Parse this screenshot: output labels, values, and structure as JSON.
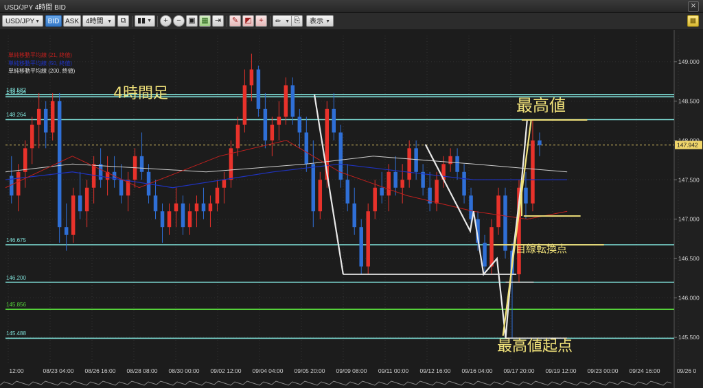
{
  "window": {
    "title": "USD/JPY 4時間 BID",
    "close_glyph": "×"
  },
  "toolbar": {
    "symbol": "USD/JPY",
    "bid_label": "BID",
    "ask_label": "ASK",
    "timeframe": "4時間",
    "display_label": "表示"
  },
  "icons": [
    "copy-icon",
    "bar-chart-icon",
    "zoom-in-icon",
    "zoom-out-icon",
    "fit-icon",
    "grid-icon",
    "scroll-icon",
    "draw-line-icon",
    "draw-shape-icon",
    "draw-fib-icon",
    "pen-icon",
    "screenshot-icon",
    "menu-icon"
  ],
  "colors": {
    "bull": "#e8322b",
    "bear": "#2f6fd6",
    "ma21": "#c0201e",
    "ma50": "#1f33c0",
    "ma200": "#cfcfcf",
    "accent_yellow": "#f1e27a",
    "hline": "#7fe0d8",
    "green_line": "#55d23a",
    "white_line": "#e8e8e8",
    "price_tag": "#f0d56a"
  },
  "chart_data": {
    "type": "candlestick",
    "title": "4時間足",
    "legend": [
      {
        "name": "単純移動平均線 (21, 終値)",
        "color": "#c0201e"
      },
      {
        "name": "単純移動平均線 (50, 終値)",
        "color": "#1f33c0"
      },
      {
        "name": "単純移動平均線 (200, 終値)",
        "color": "#dddddd"
      }
    ],
    "y_ticks": [
      "149.000",
      "148.500",
      "148.000",
      "147.500",
      "147.000",
      "146.500",
      "146.000",
      "145.500"
    ],
    "y_tick_values": [
      149.0,
      148.5,
      148.0,
      147.5,
      147.0,
      146.5,
      146.0,
      145.5
    ],
    "ylim": [
      145.17,
      149.33
    ],
    "current_price": "147.942",
    "current_price_value": 147.942,
    "x_ticks": [
      "12:00",
      "08/23 04:00",
      "08/26 16:00",
      "08/28 08:00",
      "08/30 00:00",
      "09/02 12:00",
      "09/04 04:00",
      "09/05 20:00",
      "09/09 08:00",
      "09/11 00:00",
      "09/12 16:00",
      "09/16 04:00",
      "09/17 20:00",
      "09/19 12:00",
      "09/23 00:00",
      "09/24 16:00",
      "09/26 0"
    ],
    "horizontal_lines": [
      {
        "label": "148.582",
        "value": 148.582,
        "color": "#7fe0d8"
      },
      {
        "label": "148.554",
        "value": 148.554,
        "color": "#7fe0d8"
      },
      {
        "label": "148.264",
        "value": 148.264,
        "color": "#7fe0d8"
      },
      {
        "label": "146.675",
        "value": 146.675,
        "color": "#7fe0d8"
      },
      {
        "label": "146.200",
        "value": 146.2,
        "color": "#7fe0d8"
      },
      {
        "label": "145.856",
        "value": 145.856,
        "color": "#55d23a"
      },
      {
        "label": "145.488",
        "value": 145.488,
        "color": "#7fe0d8"
      }
    ],
    "annotations": [
      "最高値",
      "目線転換点",
      "最高値起点"
    ],
    "candles": [
      [
        147.55,
        147.8,
        147.2,
        147.3
      ],
      [
        147.3,
        147.7,
        147.1,
        147.6
      ],
      [
        147.6,
        148.0,
        147.4,
        147.9
      ],
      [
        147.9,
        148.3,
        147.7,
        148.2
      ],
      [
        148.2,
        148.6,
        147.9,
        148.4
      ],
      [
        148.4,
        148.5,
        147.9,
        148.1
      ],
      [
        148.1,
        148.6,
        148.0,
        148.5
      ],
      [
        148.5,
        148.6,
        146.7,
        146.9
      ],
      [
        146.9,
        147.2,
        146.6,
        146.8
      ],
      [
        146.8,
        147.4,
        146.7,
        147.3
      ],
      [
        147.3,
        147.6,
        147.0,
        147.1
      ],
      [
        147.1,
        147.5,
        146.9,
        147.4
      ],
      [
        147.4,
        147.8,
        147.2,
        147.7
      ],
      [
        147.7,
        147.9,
        147.4,
        147.5
      ],
      [
        147.5,
        147.8,
        147.3,
        147.6
      ],
      [
        147.6,
        147.8,
        147.4,
        147.5
      ],
      [
        147.5,
        147.7,
        147.2,
        147.3
      ],
      [
        147.3,
        147.6,
        147.1,
        147.5
      ],
      [
        147.5,
        147.9,
        147.4,
        147.8
      ],
      [
        147.8,
        148.1,
        147.5,
        147.6
      ],
      [
        147.6,
        147.7,
        147.2,
        147.3
      ],
      [
        147.3,
        147.5,
        147.0,
        147.1
      ],
      [
        147.1,
        147.2,
        146.7,
        146.9
      ],
      [
        146.9,
        147.2,
        146.8,
        147.1
      ],
      [
        147.1,
        147.4,
        146.9,
        147.2
      ],
      [
        147.2,
        147.3,
        146.8,
        146.9
      ],
      [
        146.9,
        147.2,
        146.8,
        147.1
      ],
      [
        147.1,
        147.3,
        146.9,
        147.2
      ],
      [
        147.2,
        147.4,
        147.0,
        147.1
      ],
      [
        147.1,
        147.3,
        146.9,
        147.2
      ],
      [
        147.2,
        147.5,
        147.1,
        147.4
      ],
      [
        147.4,
        147.6,
        147.2,
        147.5
      ],
      [
        147.5,
        148.0,
        147.4,
        147.9
      ],
      [
        147.9,
        148.3,
        147.8,
        148.2
      ],
      [
        148.2,
        148.9,
        148.1,
        148.7
      ],
      [
        148.7,
        149.1,
        148.5,
        148.9
      ],
      [
        148.9,
        148.95,
        148.3,
        148.4
      ],
      [
        148.4,
        148.6,
        147.9,
        148.0
      ],
      [
        148.0,
        148.3,
        147.8,
        148.2
      ],
      [
        148.2,
        148.5,
        148.0,
        148.3
      ],
      [
        148.3,
        148.8,
        148.2,
        148.7
      ],
      [
        148.7,
        148.8,
        148.2,
        148.3
      ],
      [
        148.3,
        148.4,
        147.9,
        148.1
      ],
      [
        148.1,
        148.3,
        147.6,
        147.7
      ],
      [
        147.7,
        148.0,
        146.9,
        147.1
      ],
      [
        147.1,
        147.6,
        147.0,
        147.5
      ],
      [
        147.5,
        148.5,
        147.4,
        148.4
      ],
      [
        148.4,
        148.6,
        148.0,
        148.1
      ],
      [
        148.1,
        148.2,
        147.4,
        147.5
      ],
      [
        147.5,
        147.7,
        147.1,
        147.2
      ],
      [
        147.2,
        147.4,
        146.8,
        146.9
      ],
      [
        146.9,
        147.0,
        146.3,
        146.4
      ],
      [
        146.4,
        147.2,
        146.3,
        147.1
      ],
      [
        147.1,
        147.5,
        147.0,
        147.4
      ],
      [
        147.4,
        147.6,
        147.2,
        147.3
      ],
      [
        147.3,
        147.7,
        147.1,
        147.6
      ],
      [
        147.6,
        147.8,
        147.3,
        147.4
      ],
      [
        147.4,
        147.7,
        147.2,
        147.5
      ],
      [
        147.5,
        148.0,
        147.4,
        147.9
      ],
      [
        147.9,
        148.0,
        147.5,
        147.6
      ],
      [
        147.6,
        147.7,
        147.3,
        147.4
      ],
      [
        147.4,
        147.6,
        147.1,
        147.2
      ],
      [
        147.2,
        147.6,
        147.1,
        147.5
      ],
      [
        147.5,
        147.8,
        147.4,
        147.7
      ],
      [
        147.7,
        147.9,
        147.6,
        147.8
      ],
      [
        147.8,
        147.9,
        147.5,
        147.6
      ],
      [
        147.6,
        147.7,
        147.2,
        147.3
      ],
      [
        147.3,
        147.4,
        146.9,
        147.0
      ],
      [
        147.0,
        147.1,
        146.6,
        146.7
      ],
      [
        146.7,
        146.8,
        146.3,
        146.4
      ],
      [
        146.4,
        147.0,
        146.3,
        146.9
      ],
      [
        146.9,
        147.4,
        146.8,
        147.3
      ],
      [
        147.3,
        147.4,
        146.5,
        146.6
      ],
      [
        146.6,
        146.7,
        145.49,
        146.3
      ],
      [
        146.3,
        147.5,
        146.2,
        147.4
      ],
      [
        147.4,
        147.6,
        147.0,
        147.2
      ],
      [
        147.2,
        148.25,
        147.1,
        148.0
      ],
      [
        148.0,
        148.1,
        147.8,
        147.94
      ]
    ],
    "ma_series": {
      "ma21": [
        [
          0,
          147.4
        ],
        [
          0.1,
          147.8
        ],
        [
          0.2,
          147.4
        ],
        [
          0.32,
          147.8
        ],
        [
          0.42,
          148.0
        ],
        [
          0.5,
          147.6
        ],
        [
          0.6,
          147.3
        ],
        [
          0.7,
          147.1
        ],
        [
          0.78,
          147.0
        ],
        [
          0.84,
          147.1
        ]
      ],
      "ma50": [
        [
          0,
          147.5
        ],
        [
          0.1,
          147.6
        ],
        [
          0.25,
          147.4
        ],
        [
          0.4,
          147.6
        ],
        [
          0.5,
          147.7
        ],
        [
          0.6,
          147.6
        ],
        [
          0.7,
          147.5
        ],
        [
          0.84,
          147.5
        ]
      ],
      "ma200": [
        [
          0,
          147.6
        ],
        [
          0.1,
          147.7
        ],
        [
          0.3,
          147.6
        ],
        [
          0.45,
          147.7
        ],
        [
          0.55,
          147.8
        ],
        [
          0.7,
          147.7
        ],
        [
          0.84,
          147.6
        ]
      ]
    }
  }
}
